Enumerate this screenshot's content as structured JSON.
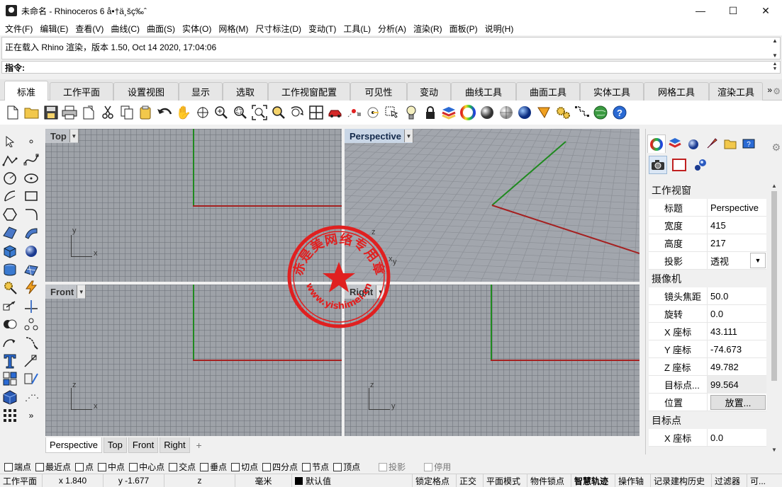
{
  "window": {
    "title": "未命名 - Rhinoceros 6 å•†ä¸šç‰ˆ",
    "controls": {
      "minimize": "—",
      "maximize": "☐",
      "close": "✕"
    }
  },
  "menu": [
    "文件(F)",
    "编辑(E)",
    "查看(V)",
    "曲线(C)",
    "曲面(S)",
    "实体(O)",
    "网格(M)",
    "尺寸标注(D)",
    "变动(T)",
    "工具(L)",
    "分析(A)",
    "渲染(R)",
    "面板(P)",
    "说明(H)"
  ],
  "history": {
    "line": "正在载入 Rhino 渲染，版本 1.50, Oct 14 2020, 17:04:06"
  },
  "command": {
    "label": "指令:",
    "value": ""
  },
  "tabs": [
    {
      "label": "标准",
      "active": true
    },
    {
      "label": "工作平面"
    },
    {
      "label": "设置视图"
    },
    {
      "label": "显示"
    },
    {
      "label": "选取"
    },
    {
      "label": "工作视窗配置"
    },
    {
      "label": "可见性"
    },
    {
      "label": "变动"
    },
    {
      "label": "曲线工具"
    },
    {
      "label": "曲面工具"
    },
    {
      "label": "实体工具"
    },
    {
      "label": "网格工具"
    },
    {
      "label": "渲染工具"
    }
  ],
  "tab_more": "»",
  "toolbar_icons": [
    "new-icon",
    "open-icon",
    "save-icon",
    "print-icon",
    "import-icon",
    "cut-icon",
    "copy-icon",
    "paste-icon",
    "undo-icon",
    "pan-icon",
    "rotate-view-icon",
    "zoom-icon",
    "zoom-window-icon",
    "zoom-extents-icon",
    "zoom-selected-icon",
    "rotate-3d-icon",
    "four-viewports-icon",
    "car-icon",
    "point-filter-icon",
    "circle-dots-icon",
    "select-icon",
    "light-bulb-icon",
    "lock-icon",
    "layer-icon",
    "color-wheel-icon",
    "shade-sphere-icon",
    "ghost-sphere-icon",
    "render-sphere-icon",
    "cone-icon",
    "gears-icon",
    "dotted-box-icon",
    "globe-icon",
    "help-icon"
  ],
  "left_tools": [
    "select-arrow-icon",
    "point-icon",
    "polyline-icon",
    "curve-icon",
    "circle-icon",
    "ellipse-icon",
    "arc-icon",
    "rectangle-icon",
    "polygon-icon",
    "fillet-icon",
    "surface-icon",
    "sweep-icon",
    "box-icon",
    "sphere-icon",
    "cylinder-icon",
    "mesh-icon",
    "gear-transform-icon",
    "lightning-icon",
    "move-icon",
    "trim-icon",
    "boolean-icon",
    "array-icon",
    "orient-icon",
    "project-icon",
    "text-icon",
    "dimension-icon",
    "group-icon",
    "block-icon",
    "solid-box-icon",
    "explode-icon",
    "grid-icon",
    "more-icon"
  ],
  "viewports": [
    {
      "name": "Top",
      "active": false,
      "axis_a": "y",
      "axis_b": "x"
    },
    {
      "name": "Perspective",
      "active": true,
      "axis_a": "z",
      "axis_b": "y",
      "axis_c": "x"
    },
    {
      "name": "Front",
      "active": false,
      "axis_a": "z",
      "axis_b": "x"
    },
    {
      "name": "Right",
      "active": false,
      "axis_a": "z",
      "axis_b": "y"
    }
  ],
  "viewport_tabs": [
    {
      "label": "Perspective",
      "active": true
    },
    {
      "label": "Top"
    },
    {
      "label": "Front"
    },
    {
      "label": "Right"
    }
  ],
  "viewport_tab_add": "+",
  "panel": {
    "tabs": [
      "color-wheel-tab-icon",
      "layer-tab-icon",
      "material-tab-icon",
      "brush-tab-icon",
      "folder-tab-icon",
      "help-tab-icon"
    ],
    "subtabs": [
      "camera-icon",
      "viewport-frame-icon",
      "object-spheres-icon"
    ],
    "sections": [
      {
        "title": "工作视窗",
        "rows": [
          {
            "k": "标题",
            "v": "Perspective"
          },
          {
            "k": "宽度",
            "v": "415"
          },
          {
            "k": "高度",
            "v": "217"
          },
          {
            "k": "投影",
            "v": "透视",
            "select": true
          }
        ]
      },
      {
        "title": "摄像机",
        "rows": [
          {
            "k": "镜头焦距",
            "v": "50.0"
          },
          {
            "k": "旋转",
            "v": "0.0"
          },
          {
            "k": "X 座标",
            "v": "43.111"
          },
          {
            "k": "Y 座标",
            "v": "-74.673"
          },
          {
            "k": "Z 座标",
            "v": "49.782"
          },
          {
            "k": "目标点...",
            "v": "99.564",
            "shade": true
          },
          {
            "k": "位置",
            "v": "放置...",
            "button": true
          }
        ]
      },
      {
        "title": "目标点",
        "rows": [
          {
            "k": "X 座标",
            "v": "0.0"
          }
        ]
      }
    ]
  },
  "osnaps": [
    {
      "label": "端点"
    },
    {
      "label": "最近点"
    },
    {
      "label": "点"
    },
    {
      "label": "中点"
    },
    {
      "label": "中心点"
    },
    {
      "label": "交点"
    },
    {
      "label": "垂点"
    },
    {
      "label": "切点"
    },
    {
      "label": "四分点"
    },
    {
      "label": "节点"
    },
    {
      "label": "顶点"
    },
    {
      "label": "投影",
      "disabled": true
    },
    {
      "label": "停用",
      "disabled": true
    }
  ],
  "status": {
    "cplane": "工作平面",
    "x": "x 1.840",
    "y": "y -1.677",
    "z": "z",
    "unit": "毫米",
    "layer": "默认值",
    "toggles": [
      "锁定格点",
      "正交",
      "平面模式",
      "物件锁点",
      "智慧轨迹",
      "操作轴",
      "记录建构历史",
      "过滤器",
      "可..."
    ]
  },
  "watermark": {
    "top_arc": "赤是美网络专用章",
    "bottom_arc": "www.yishimei.cn"
  },
  "colors": {
    "x_axis": "#a52020",
    "y_axis": "#1f8a1f",
    "grid_bg": "#9ea2a8",
    "stamp": "#e02020"
  }
}
